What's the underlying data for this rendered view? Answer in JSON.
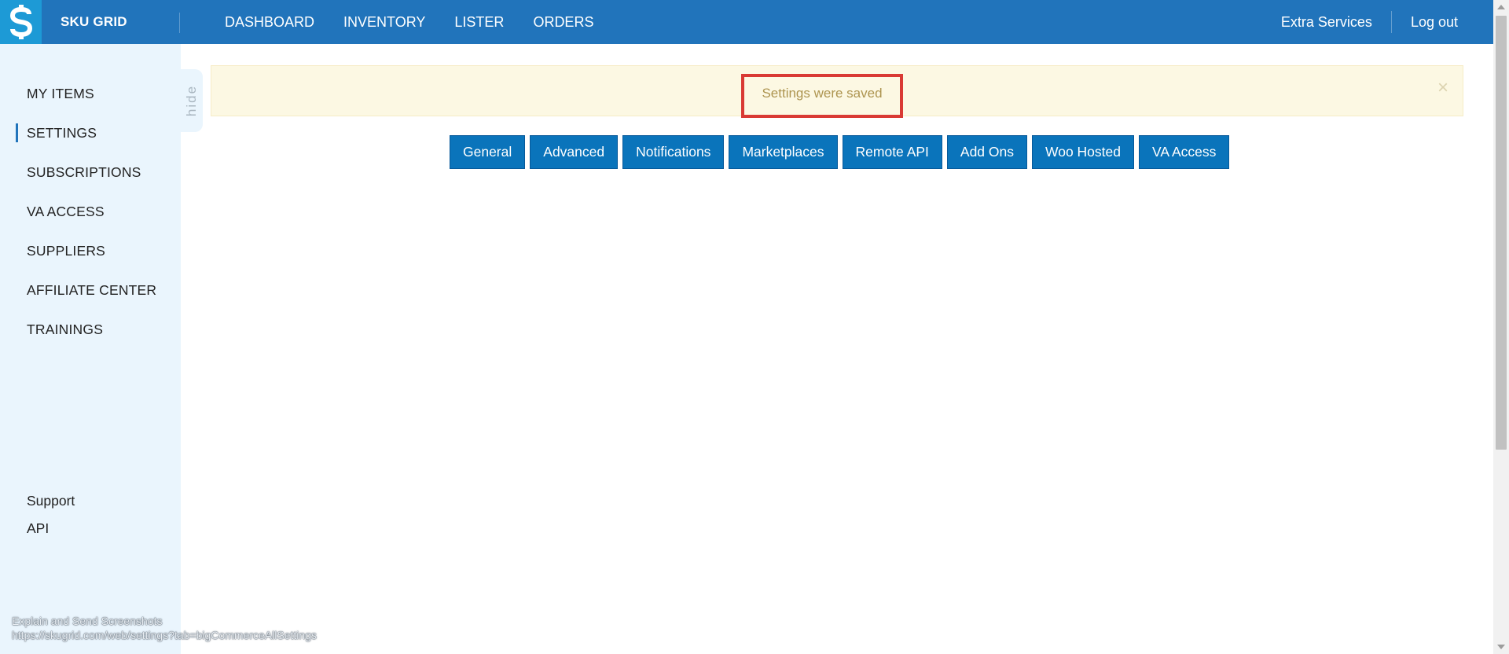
{
  "topbar": {
    "brand": "SKU GRID",
    "logo_icon": "dollar-sign-icon",
    "nav": [
      "DASHBOARD",
      "INVENTORY",
      "LISTER",
      "ORDERS"
    ],
    "extra_services": "Extra Services",
    "logout": "Log out"
  },
  "sidebar": {
    "items": [
      {
        "label": "MY ITEMS",
        "active": false
      },
      {
        "label": "SETTINGS",
        "active": true
      },
      {
        "label": "SUBSCRIPTIONS",
        "active": false
      },
      {
        "label": "VA ACCESS",
        "active": false
      },
      {
        "label": "SUPPLIERS",
        "active": false
      },
      {
        "label": "AFFILIATE CENTER",
        "active": false
      },
      {
        "label": "TRAININGS",
        "active": false
      }
    ],
    "footer": [
      "Support",
      "API"
    ],
    "hide_label": "hide"
  },
  "alert": {
    "message": "Settings were saved",
    "close": "×"
  },
  "tabs": [
    "General",
    "Advanced",
    "Notifications",
    "Marketplaces",
    "Remote API",
    "Add Ons",
    "Woo Hosted",
    "VA Access"
  ],
  "status": {
    "line1": "Explain and Send Screenshots",
    "line2": "https://skugrid.com/web/settings?tab=bigCommerceAllSettings"
  },
  "colors": {
    "topbar": "#2174bb",
    "logo_bg": "#1d9ad6",
    "sidebar_bg": "#eaf5fd",
    "alert_bg": "#fcf8e3",
    "alert_text": "#ad944f",
    "highlight_border": "#d93a34",
    "tab_button": "#0a74bb"
  }
}
